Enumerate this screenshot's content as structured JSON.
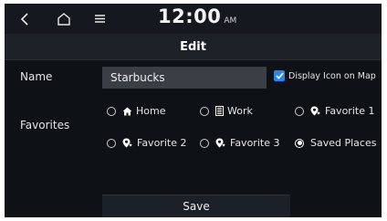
{
  "status_bar": {
    "time": "12:00",
    "ampm": "AM"
  },
  "title": "Edit",
  "form": {
    "name_label": "Name",
    "name_value": "Starbucks",
    "display_icon_label": "Display Icon on Map",
    "display_icon_checked": true,
    "favorites_label": "Favorites",
    "options": [
      {
        "label": "Home",
        "icon": "home-icon",
        "selected": false
      },
      {
        "label": "Work",
        "icon": "building-icon",
        "selected": false
      },
      {
        "label": "Favorite 1",
        "icon": "favorite-pin-icon",
        "selected": false
      },
      {
        "label": "Favorite 2",
        "icon": "favorite-pin-icon",
        "selected": false
      },
      {
        "label": "Favorite 3",
        "icon": "favorite-pin-icon",
        "selected": false
      },
      {
        "label": "Saved Places",
        "icon": "",
        "selected": true
      }
    ]
  },
  "save_label": "Save",
  "colors": {
    "accent": "#2d86e6",
    "background": "#0e1116",
    "input": "#3a3e45"
  }
}
